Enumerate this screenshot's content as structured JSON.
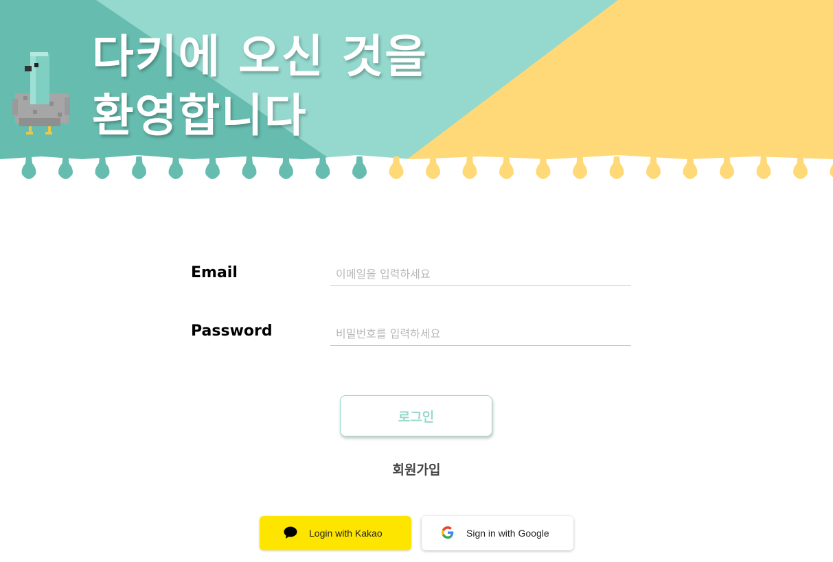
{
  "header": {
    "welcome_line1": "다키에 오신 것을",
    "welcome_line2": "환영합니다"
  },
  "colors": {
    "teal_dark": "#66bcaf",
    "teal_light": "#95d9ce",
    "yellow": "#ffd877",
    "login_accent": "#96d8cb",
    "kakao_yellow": "#fee500"
  },
  "form": {
    "email_label": "Email",
    "email_placeholder": "이메일을 입력하세요",
    "password_label": "Password",
    "password_placeholder": "비밀번호를 입력하세요",
    "login_button": "로그인",
    "signup_link": "회원가입"
  },
  "social": {
    "kakao_label": "Login with Kakao",
    "kakao_icon": "speech-bubble-icon",
    "google_label": "Sign in with Google",
    "google_icon": "google-g-icon"
  }
}
